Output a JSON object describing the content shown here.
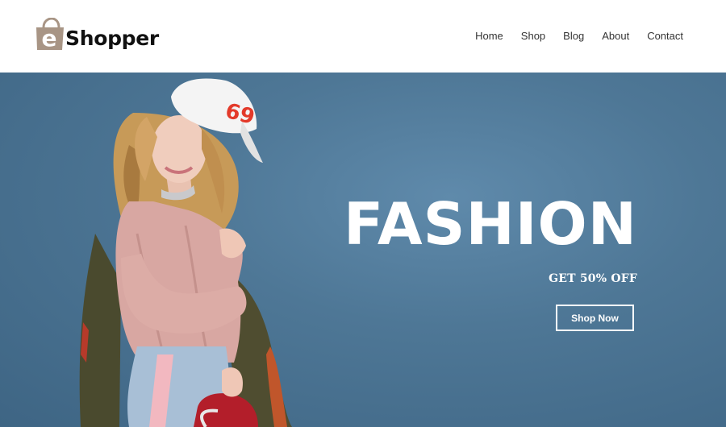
{
  "brand": {
    "logo_letter": "e",
    "logo_text": "Shopper"
  },
  "nav": {
    "items": [
      {
        "label": "Home"
      },
      {
        "label": "Shop"
      },
      {
        "label": "Blog"
      },
      {
        "label": "About"
      },
      {
        "label": "Contact"
      }
    ]
  },
  "hero": {
    "title": "FASHION",
    "subtitle": "GET 50% OFF",
    "button_label": "Shop Now",
    "cap_number": "69"
  },
  "colors": {
    "hero_background": "#4e7796",
    "logo_bag": "#a89585",
    "text_dark": "#111111",
    "white": "#ffffff"
  }
}
